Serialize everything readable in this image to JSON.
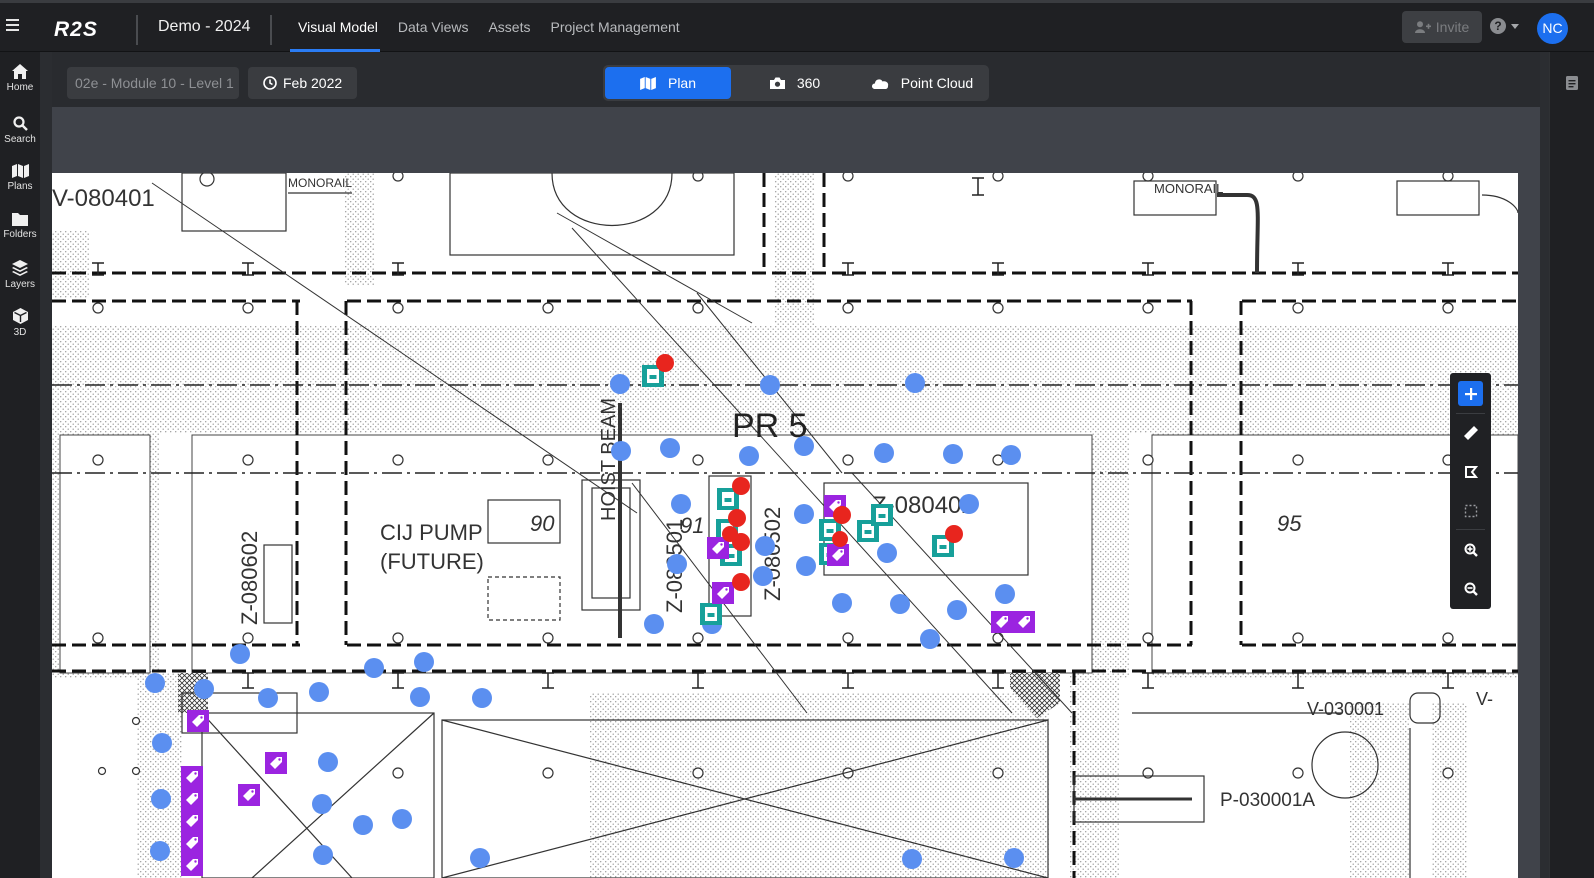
{
  "app": {
    "logo_text": "R2S",
    "project_title": "Demo - 2024"
  },
  "nav": {
    "tabs": [
      {
        "label": "Visual Model",
        "active": true
      },
      {
        "label": "Data Views"
      },
      {
        "label": "Assets"
      },
      {
        "label": "Project Management"
      }
    ]
  },
  "header": {
    "invite_label": "Invite",
    "help_icon": "question-circle-icon",
    "avatar_initials": "NC"
  },
  "sidebar": {
    "items": [
      {
        "label": "Home",
        "icon": "home-icon"
      },
      {
        "label": "Search",
        "icon": "search-icon"
      },
      {
        "label": "Plans",
        "icon": "map-icon"
      },
      {
        "label": "Folders",
        "icon": "folder-icon"
      },
      {
        "label": "Layers",
        "icon": "layers-icon"
      },
      {
        "label": "3D",
        "icon": "cube-icon"
      }
    ]
  },
  "toolbar": {
    "location": "02e - Module 10 - Level 1",
    "date": "Feb 2022",
    "views": [
      {
        "label": "Plan",
        "icon": "map-icon",
        "active": true
      },
      {
        "label": "360",
        "icon": "camera-icon"
      },
      {
        "label": "Point Cloud",
        "icon": "cloud-icon"
      }
    ]
  },
  "drawing": {
    "labels": {
      "pr5": "PR 5",
      "cij_pump": "CIJ PUMP",
      "future": "(FUTURE)",
      "v080401": "V-080401",
      "monorail_1": "MONORAIL",
      "monorail_2": "MONORAIL",
      "z080602": "Z-080602",
      "z080501": "Z-080501",
      "z080502": "Z-080502",
      "z080402": "Z-080402",
      "hoist_beam": "HOIST BEAM",
      "v030001": "V-030001",
      "p030001a": "P-030001A",
      "n90": "90",
      "n91": "91",
      "n95": "95",
      "v_edge": "V-"
    },
    "marker_colors": {
      "point": "#5b8ff0",
      "issue": "#e8251e",
      "document": "#17a09a",
      "tag": "#9b24e0"
    }
  },
  "map_tools": [
    {
      "icon": "plus-icon"
    },
    {
      "icon": "ruler-icon"
    },
    {
      "icon": "polygon-select-icon"
    },
    {
      "icon": "rectangle-select-icon"
    },
    {
      "icon": "zoom-in-icon"
    },
    {
      "icon": "zoom-out-icon"
    }
  ]
}
